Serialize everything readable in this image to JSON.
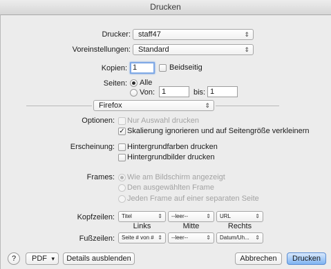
{
  "window": {
    "title": "Drucken"
  },
  "printer": {
    "label": "Drucker:",
    "value": "staff47"
  },
  "presets": {
    "label": "Voreinstellungen:",
    "value": "Standard"
  },
  "copies": {
    "label": "Kopien:",
    "value": "1",
    "duplex_label": "Beidseitig",
    "duplex_checked": false
  },
  "pages": {
    "label": "Seiten:",
    "all_label": "Alle",
    "from_label": "Von:",
    "from_value": "1",
    "to_label": "bis:",
    "to_value": "1",
    "selected": "all"
  },
  "section_menu": {
    "value": "Firefox"
  },
  "options": {
    "label": "Optionen:",
    "selection_only": {
      "label": "Nur Auswahl drucken",
      "checked": false,
      "enabled": false
    },
    "shrink_to_fit": {
      "label": "Skalierung ignorieren und auf Seitengröße verkleinern",
      "checked": true,
      "enabled": true
    }
  },
  "appearance": {
    "label": "Erscheinung:",
    "bg_colors": {
      "label": "Hintergrundfarben drucken",
      "checked": false
    },
    "bg_images": {
      "label": "Hintergrundbilder drucken",
      "checked": false
    }
  },
  "frames": {
    "label": "Frames:",
    "items": [
      {
        "label": "Wie am Bildschirm angezeigt",
        "selected": true
      },
      {
        "label": "Den ausgewählten Frame",
        "selected": false
      },
      {
        "label": "Jeden Frame auf einer separaten Seite",
        "selected": false
      }
    ]
  },
  "headers": {
    "label": "Kopfzeilen:",
    "left": "Titel",
    "center": "--leer--",
    "right": "URL"
  },
  "columns": {
    "left": "Links",
    "center": "Mitte",
    "right": "Rechts"
  },
  "footers": {
    "label": "Fußzeilen:",
    "left": "Seite # von #",
    "center": "--leer--",
    "right": "Datum/Uh..."
  },
  "bottom_bar": {
    "help": "?",
    "pdf": "PDF",
    "details": "Details ausblenden",
    "cancel": "Abbrechen",
    "print": "Drucken"
  },
  "icons": {
    "popup_arrows": "⇕",
    "pdf_arrow": "▾",
    "check": "✓"
  },
  "colors": {
    "default_button": "#7eb3f1",
    "focus_ring": "#7fa9e6",
    "disabled_text": "#a3a3a3"
  }
}
